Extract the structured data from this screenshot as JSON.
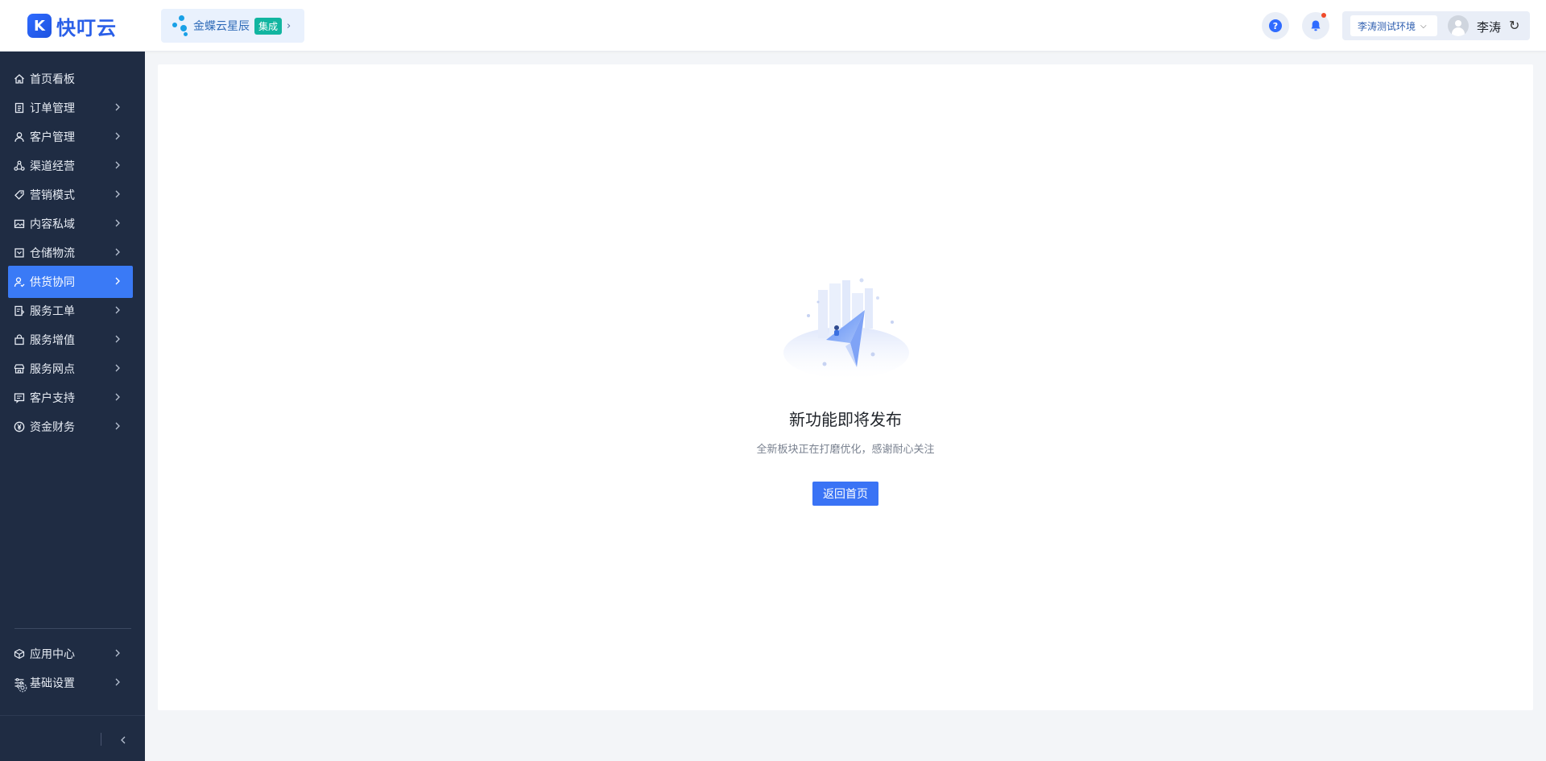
{
  "brand": {
    "name": "快叮云",
    "mark": "K"
  },
  "partner": {
    "name": "金蝶云星辰",
    "badge": "集成"
  },
  "header": {
    "help_glyph": "?",
    "env_select": "李涛测试环境",
    "user_name": "李涛"
  },
  "sidebar": {
    "items": [
      {
        "label": "首页看板",
        "icon": "home-icon",
        "has_arrow": false
      },
      {
        "label": "订单管理",
        "icon": "clipboard-icon",
        "has_arrow": true
      },
      {
        "label": "客户管理",
        "icon": "user-icon",
        "has_arrow": true
      },
      {
        "label": "渠道经营",
        "icon": "channel-icon",
        "has_arrow": true
      },
      {
        "label": "营销模式",
        "icon": "tag-icon",
        "has_arrow": true
      },
      {
        "label": "内容私域",
        "icon": "image-icon",
        "has_arrow": true
      },
      {
        "label": "仓储物流",
        "icon": "box-icon",
        "has_arrow": true
      },
      {
        "label": "供货协同",
        "icon": "supply-icon",
        "has_arrow": true,
        "active": true
      },
      {
        "label": "服务工单",
        "icon": "ticket-icon",
        "has_arrow": true
      },
      {
        "label": "服务增值",
        "icon": "bag-icon",
        "has_arrow": true
      },
      {
        "label": "服务网点",
        "icon": "store-icon",
        "has_arrow": true
      },
      {
        "label": "客户支持",
        "icon": "support-icon",
        "has_arrow": true
      },
      {
        "label": "资金财务",
        "icon": "yen-icon",
        "has_arrow": true
      }
    ],
    "bottom_items": [
      {
        "label": "应用中心",
        "icon": "cube-icon"
      },
      {
        "label": "基础设置",
        "icon": "settings-list-icon"
      }
    ]
  },
  "main": {
    "title": "新功能即将发布",
    "subtitle": "全新板块正在打磨优化，感谢耐心关注",
    "home_button": "返回首页"
  },
  "colors": {
    "sidebar_bg": "#1f2c43",
    "accent": "#3a7af6",
    "partner_bg": "#e9f1fd",
    "badge": "#12b5a0"
  }
}
